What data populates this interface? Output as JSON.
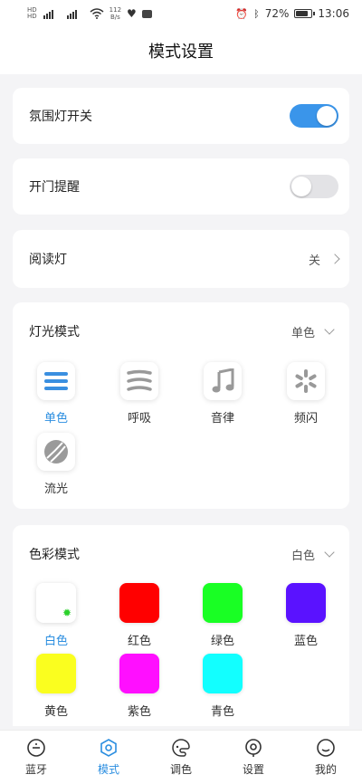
{
  "status_bar": {
    "sim_labels": [
      "HD",
      "HD"
    ],
    "signal": "46",
    "speed_value": "112",
    "speed_unit": "B/s",
    "battery_percent": "72%",
    "time": "13:06"
  },
  "header": {
    "title": "模式设置"
  },
  "settings": {
    "ambient_light": {
      "label": "氛围灯开关",
      "enabled": true
    },
    "door_reminder": {
      "label": "开门提醒",
      "enabled": false
    },
    "reading_light": {
      "label": "阅读灯",
      "value": "关"
    }
  },
  "light_mode": {
    "title": "灯光模式",
    "selected_value": "单色",
    "items": [
      {
        "label": "单色",
        "icon": "lines-icon",
        "active": true
      },
      {
        "label": "呼吸",
        "icon": "wave-icon",
        "active": false
      },
      {
        "label": "音律",
        "icon": "music-note-icon",
        "active": false
      },
      {
        "label": "频闪",
        "icon": "flash-icon",
        "active": false
      },
      {
        "label": "流光",
        "icon": "ball-icon",
        "active": false
      }
    ]
  },
  "color_mode": {
    "title": "色彩模式",
    "selected_value": "白色",
    "items": [
      {
        "label": "白色",
        "color": "#ffffff",
        "active": true
      },
      {
        "label": "红色",
        "color": "#ff0000",
        "active": false
      },
      {
        "label": "绿色",
        "color": "#19ff24",
        "active": false
      },
      {
        "label": "蓝色",
        "color": "#5a12ff",
        "active": false
      },
      {
        "label": "黄色",
        "color": "#fafe1f",
        "active": false
      },
      {
        "label": "紫色",
        "color": "#ff0fff",
        "active": false
      },
      {
        "label": "青色",
        "color": "#12ffff",
        "active": false
      }
    ]
  },
  "colors": {
    "accent": "#2b8ee0",
    "toggle_on": "#3a95ea"
  },
  "tabbar": {
    "items": [
      {
        "label": "蓝牙",
        "icon": "bluetooth-icon",
        "active": false
      },
      {
        "label": "模式",
        "icon": "mode-icon",
        "active": true
      },
      {
        "label": "调色",
        "icon": "palette-icon",
        "active": false
      },
      {
        "label": "设置",
        "icon": "settings-icon",
        "active": false
      },
      {
        "label": "我的",
        "icon": "profile-icon",
        "active": false
      }
    ]
  }
}
